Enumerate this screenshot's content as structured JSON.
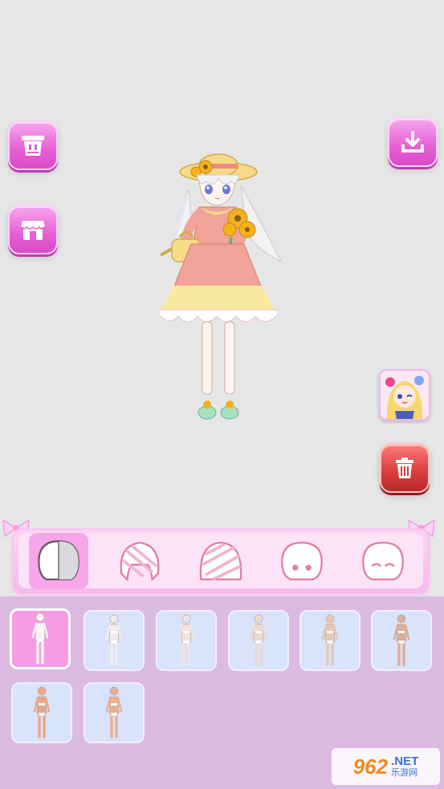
{
  "buttons": {
    "wardrobe": "wardrobe-icon",
    "shop": "shop-icon",
    "download": "download-icon",
    "character": "character-avatar",
    "delete": "trash-icon"
  },
  "categories": [
    {
      "name": "body",
      "active": true
    },
    {
      "name": "hair-back",
      "active": false
    },
    {
      "name": "hair-front",
      "active": false
    },
    {
      "name": "face",
      "active": false
    },
    {
      "name": "expression",
      "active": false
    }
  ],
  "items": [
    {
      "skin": "#f8f4f4",
      "selected": true
    },
    {
      "skin": "#f2ecea",
      "selected": false
    },
    {
      "skin": "#f0e4e0",
      "selected": false
    },
    {
      "skin": "#eed9d1",
      "selected": false
    },
    {
      "skin": "#e6c7b6",
      "selected": false
    },
    {
      "skin": "#d8b09c",
      "selected": false
    },
    {
      "skin": "#e9a987",
      "selected": false
    },
    {
      "skin": "#e7b196",
      "selected": false
    }
  ],
  "watermark": {
    "number": "962",
    "net": ".NET",
    "cn": "乐游网"
  },
  "colors": {
    "accent": "#e65fd4",
    "panel": "#dbbbe2",
    "tile": "#d9e3fb",
    "danger": "#d93c3c"
  }
}
